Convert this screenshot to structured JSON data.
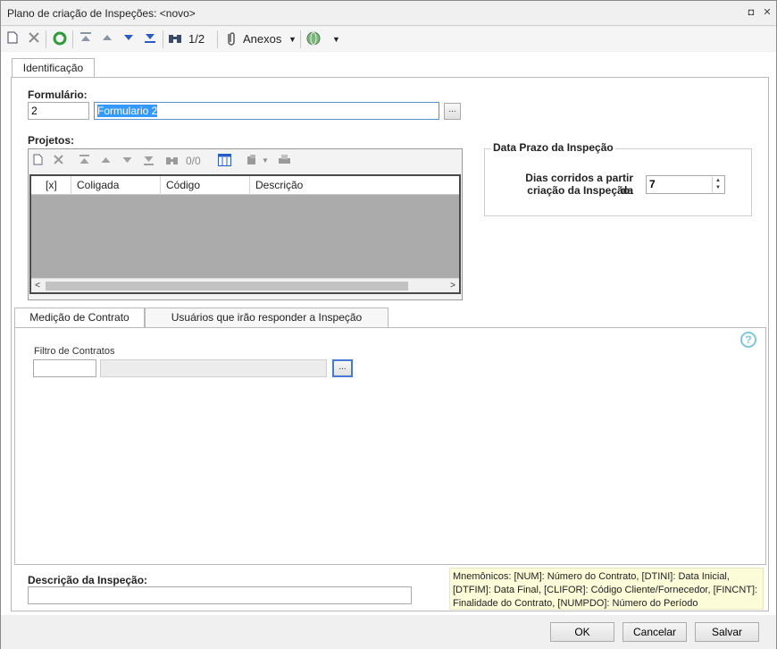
{
  "window": {
    "title": "Plano de criação de Inspeções: <novo>",
    "controls": {
      "restore": "◘",
      "close": "✕"
    }
  },
  "toolbar": {
    "record_position": "1/2",
    "attachments_label": "Anexos"
  },
  "tabs": {
    "identification": "Identificação"
  },
  "form": {
    "label": "Formulário:",
    "code_value": "2",
    "name_value": "Formulario 2",
    "lookup_label": "..."
  },
  "projects": {
    "label": "Projetos:",
    "counter": "0/0",
    "columns": [
      "[x]",
      "Coligada",
      "Código",
      "Descrição"
    ]
  },
  "deadline": {
    "group_title": "Data Prazo da Inspeção",
    "days_label_line1": "Dias corridos a partir da",
    "days_label_line2": "criação da Inspeção:",
    "days_value": "7"
  },
  "subtabs": {
    "contract": "Medição de Contrato",
    "users": "Usuários que irão responder a Inspeção"
  },
  "contract_filter": {
    "label": "Filtro de Contratos",
    "code_value": "",
    "description_value": "",
    "lookup_label": "..."
  },
  "description": {
    "label": "Descrição da Inspeção:",
    "value": ""
  },
  "mnemonics": "Mnemônicos: [NUM]: Número do Contrato, [DTINI]: Data Inicial, [DTFIM]: Data Final, [CLIFOR]: Código Cliente/Fornecedor, [FINCNT]: Finalidade do Contrato, [NUMPDO]: Número do Período",
  "buttons": {
    "ok": "OK",
    "cancel": "Cancelar",
    "save": "Salvar"
  },
  "colors": {
    "help_accent": "#7fc7d6",
    "selection": "#3399ff",
    "grid_background": "#ababab",
    "mnemonic_background": "#fcfcd8"
  }
}
